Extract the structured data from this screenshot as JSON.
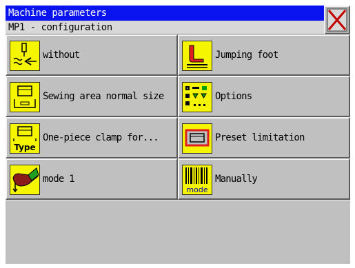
{
  "window": {
    "title": "Machine parameters",
    "subtitle": "MP1 - configuration",
    "close_icon": "close-x-icon"
  },
  "buttons": [
    {
      "label": "without",
      "icon": "thread-trimmer-icon"
    },
    {
      "label": "Jumping foot",
      "icon": "jumping-foot-icon"
    },
    {
      "label": "Sewing area normal size",
      "icon": "sewing-area-icon"
    },
    {
      "label": "Options",
      "icon": "options-icon"
    },
    {
      "label": "One-piece clamp for...",
      "icon": "clamp-type-icon"
    },
    {
      "label": "Preset limitation",
      "icon": "preset-limitation-icon"
    },
    {
      "label": "mode 1",
      "icon": "pedal-mode-icon"
    },
    {
      "label": "Manually",
      "icon": "barcode-mode-icon"
    }
  ],
  "icon_text": {
    "type": "Type",
    "mode": "mode"
  },
  "colors": {
    "title_bg": "#0a14f0",
    "icon_bg": "#f5f500",
    "close_x": "#c00000",
    "panel": "#c0c0c0"
  }
}
